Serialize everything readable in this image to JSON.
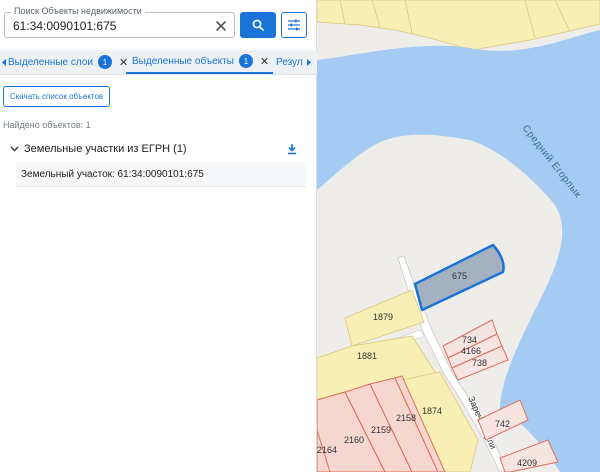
{
  "search": {
    "label": "Поиск Объекты недвижимости",
    "value": "61:34:0090101:675"
  },
  "tabs": [
    {
      "label": "Выделенные слои",
      "count": "1"
    },
    {
      "label": "Выделенные объекты",
      "count": "1"
    },
    {
      "label": "Резул"
    }
  ],
  "actions": {
    "download_list_label": "Скачать список объектов"
  },
  "results": {
    "found_text": "Найдено объектов: 1",
    "group_title": "Земельные участки из ЕГРН (1)",
    "items": [
      {
        "label": "Земельный участок: 61:34:0090101:675"
      }
    ]
  },
  "map": {
    "river_label": "Средний Егорлык",
    "street_label": "Заречная ули",
    "parcels": [
      "675",
      "1879",
      "1881",
      "1874",
      "2158",
      "2159",
      "2160",
      "2164",
      "734",
      "4166",
      "738",
      "742",
      "4209"
    ],
    "colors": {
      "water": "#a6cbf2",
      "parcel_yellow": "#f7efb4",
      "parcel_red": "#e06c5a",
      "selected_fill": "#a5b1c1",
      "selected_stroke": "#1a73d9"
    }
  },
  "icons": {
    "clear": "close-icon",
    "search": "search-icon",
    "filter": "tune-icon",
    "download": "download-icon",
    "expand": "chevron-down-icon"
  }
}
